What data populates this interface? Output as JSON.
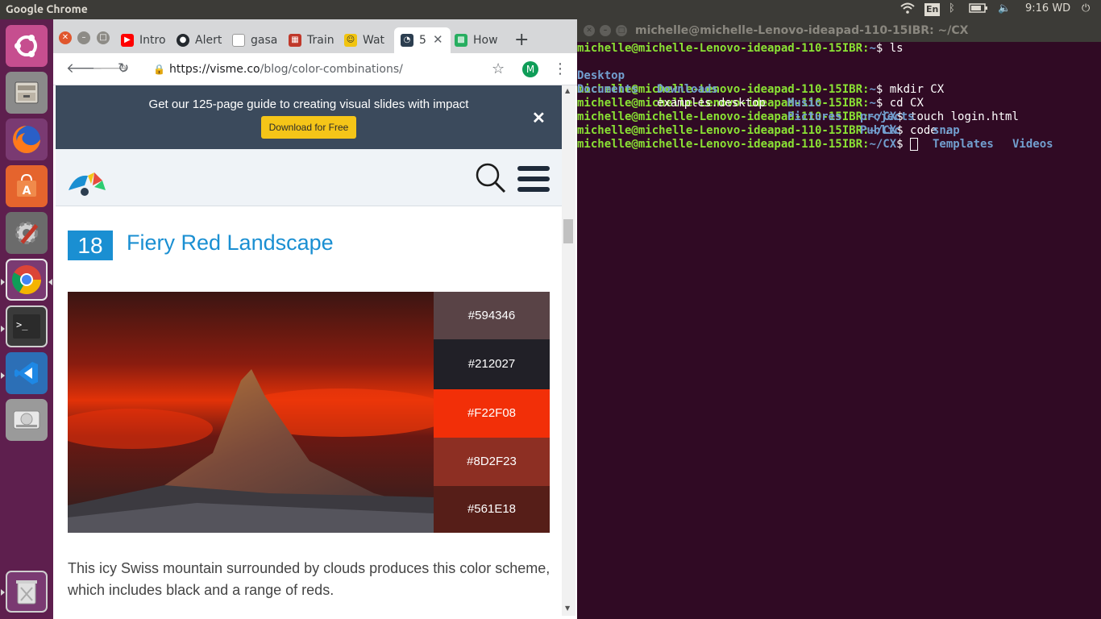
{
  "topbar": {
    "app_name": "Google Chrome",
    "keyboard": "En",
    "time": "9:16 WD"
  },
  "launcher": {
    "items": [
      "ubuntu-dash",
      "files",
      "firefox",
      "software-center",
      "system-settings",
      "chrome",
      "terminal",
      "vscode",
      "disk",
      "trash"
    ]
  },
  "chrome": {
    "tabs": [
      {
        "label": "Intro",
        "icon": "youtube-icon",
        "color": "#ff0000"
      },
      {
        "label": "Alert",
        "icon": "github-icon",
        "color": "#24292e"
      },
      {
        "label": "gasa",
        "icon": "page-icon",
        "color": "#bbbbbb"
      },
      {
        "label": "Train",
        "icon": "train-icon",
        "color": "#c0392b"
      },
      {
        "label": "Wat",
        "icon": "wat-icon",
        "color": "#f1c40f"
      },
      {
        "label": "5",
        "icon": "visme-icon",
        "color": "#2c3e50"
      },
      {
        "label": "How",
        "icon": "how-icon",
        "color": "#27ae60"
      }
    ],
    "url_host": "https://visme.co",
    "url_path": "/blog/color-combinations/",
    "profile_initial": "M"
  },
  "page": {
    "banner_text": "Get our 125-page guide to creating visual slides with impact",
    "banner_button": "Download for Free",
    "banner_close": "✕",
    "number": "18",
    "title": "Fiery Red Landscape",
    "swatches": [
      {
        "hex": "#594346"
      },
      {
        "hex": "#212027"
      },
      {
        "hex": "#F22F08"
      },
      {
        "hex": "#8D2F23"
      },
      {
        "hex": "#561E18"
      }
    ],
    "description": "This icy Swiss mountain surrounded by clouds produces this color scheme, which includes black and a range of reds."
  },
  "terminal": {
    "title": "michelle@michelle-Lenovo-ideapad-110-15IBR: ~/CX",
    "lines": [
      {
        "prompt": "michelle@michelle-Lenovo-ideapad-110-15IBR:",
        "path": "~",
        "cmd": "$ ls"
      },
      {
        "listing": [
          "Desktop",
          "Downloads",
          "Music",
          "projects",
          "snap",
          "Videos"
        ]
      },
      {
        "listing": [
          "Documents",
          "examples.desktop",
          "Pictures",
          "Public",
          "Templates"
        ]
      },
      {
        "prompt": "michelle@michelle-Lenovo-ideapad-110-15IBR:",
        "path": "~",
        "cmd": "$ mkdir CX"
      },
      {
        "prompt": "michelle@michelle-Lenovo-ideapad-110-15IBR:",
        "path": "~",
        "cmd": "$ cd CX"
      },
      {
        "prompt": "michelle@michelle-Lenovo-ideapad-110-15IBR:",
        "path": "~/CX",
        "cmd": "$ touch login.html"
      },
      {
        "prompt": "michelle@michelle-Lenovo-ideapad-110-15IBR:",
        "path": "~/CX",
        "cmd": "$ code ."
      },
      {
        "prompt": "michelle@michelle-Lenovo-ideapad-110-15IBR:",
        "path": "~/CX",
        "cmd": "$ "
      }
    ]
  }
}
